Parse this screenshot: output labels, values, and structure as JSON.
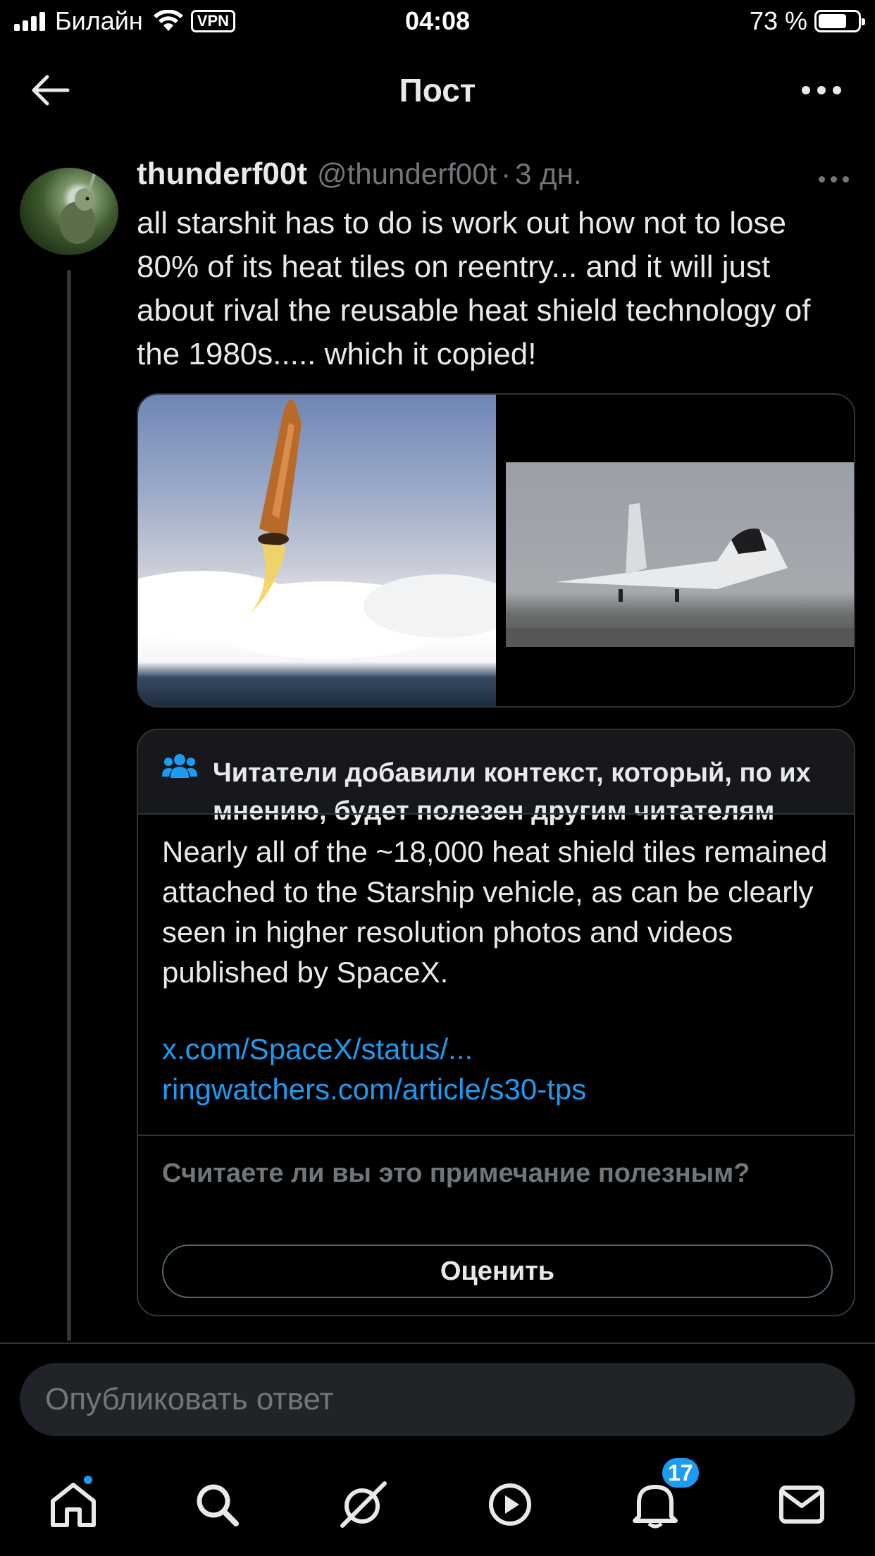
{
  "status_bar": {
    "carrier": "Билайн",
    "vpn": "VPN",
    "time": "04:08",
    "battery_percent": "73 %",
    "battery_level": 0.73
  },
  "header": {
    "title": "Пост"
  },
  "tweet": {
    "display_name": "thunderf00t",
    "handle": "@thunderf00t",
    "separator": "·",
    "time_ago": "3 дн.",
    "text": "all starshit has to do is work out how not to lose 80% of its heat tiles on reentry... and it will just about rival the reusable heat shield technology of the 1980s..... which it copied!"
  },
  "community_note": {
    "title": "Читатели добавили контекст, который, по их мнению, будет полезен другим читателям",
    "body": "Nearly all of the ~18,000 heat shield tiles remained attached to the Starship vehicle, as can be clearly seen in higher resolution photos and videos published by SpaceX.",
    "links": [
      "x.com/SpaceX/status/...",
      "ringwatchers.com/article/s30-tps"
    ],
    "question": "Считаете ли вы это примечание полезным?",
    "rate_label": "Оценить"
  },
  "reply": {
    "placeholder": "Опубликовать ответ"
  },
  "tabbar": {
    "notifications_count": "17"
  },
  "colors": {
    "accent": "#1d9bf0",
    "background": "#000000",
    "muted_text": "#71767b",
    "border": "#2f3336"
  }
}
